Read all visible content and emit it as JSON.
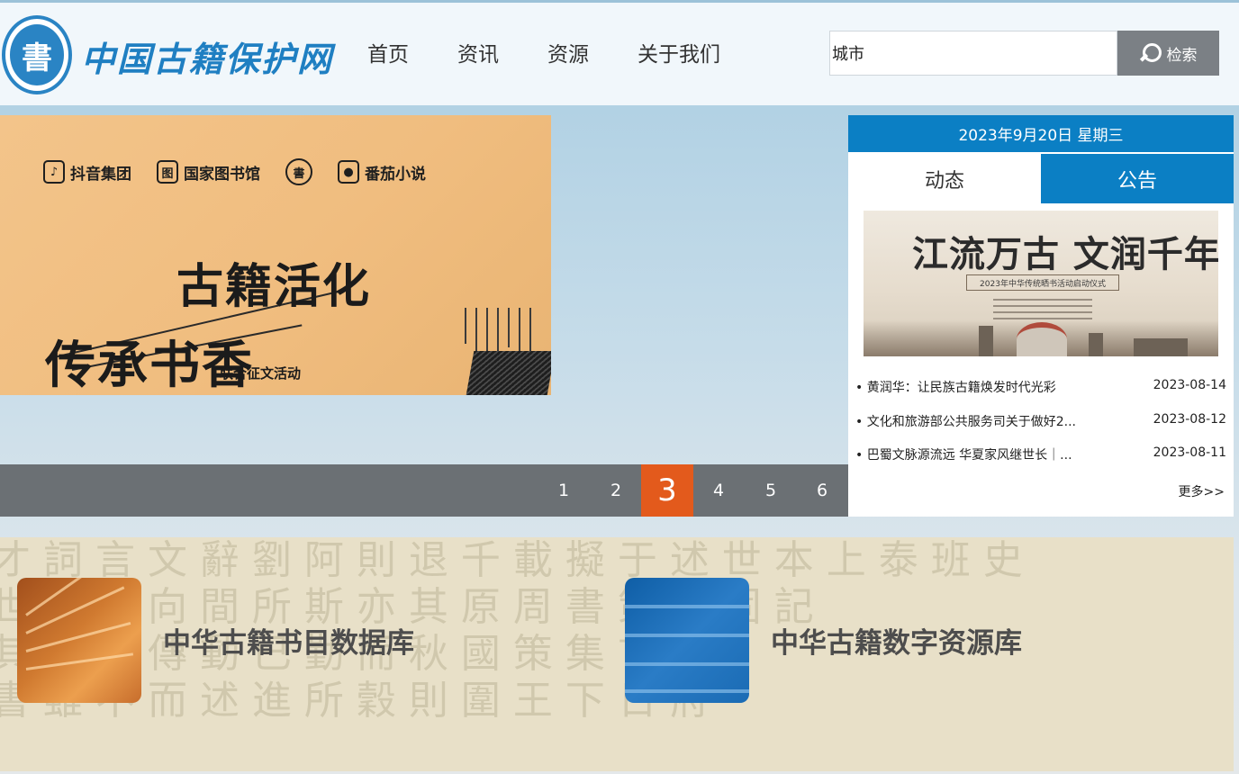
{
  "header": {
    "logo_seal": "書",
    "logo_text": "中国古籍保护网",
    "nav": [
      "首页",
      "资讯",
      "资源",
      "关于我们"
    ],
    "search": {
      "value": "城市",
      "button_label": "检索"
    }
  },
  "banner": {
    "brands": [
      {
        "label": "抖音集团",
        "icon": "douyin-icon"
      },
      {
        "label": "国家图书馆",
        "icon": "nlc-icon"
      },
      {
        "label": "",
        "icon": "seal-icon"
      },
      {
        "label": "番茄小说",
        "icon": "fanqie-icon"
      }
    ],
    "title_line1": "古籍活化",
    "title_line2": "传承书香",
    "subtitle": "联合征文活动"
  },
  "pager": {
    "pages": [
      "1",
      "2",
      "3",
      "4",
      "5",
      "6"
    ],
    "active": "3"
  },
  "panel": {
    "date": "2023年9月20日 星期三",
    "tabs": [
      "动态",
      "公告"
    ],
    "feature": {
      "title": "江流万古 文润千年",
      "subtitle": "2023年中华传统晒书活动启动仪式"
    },
    "news": [
      {
        "title": "黄润华：让民族古籍焕发时代光彩",
        "date": "2023-08-14"
      },
      {
        "title": "文化和旅游部公共服务司关于做好2...",
        "date": "2023-08-12"
      },
      {
        "title": "巴蜀文脉源流远 华夏家风继世长｜...",
        "date": "2023-08-11"
      }
    ],
    "more": "更多>>"
  },
  "databases": [
    {
      "title": "中华古籍书目数据库"
    },
    {
      "title": "中华古籍数字资源库"
    }
  ],
  "colors": {
    "brand_blue": "#0b7fc4",
    "active_page": "#e35a1c",
    "pager_bg": "#6b7074",
    "search_btn": "#7b8085"
  }
}
